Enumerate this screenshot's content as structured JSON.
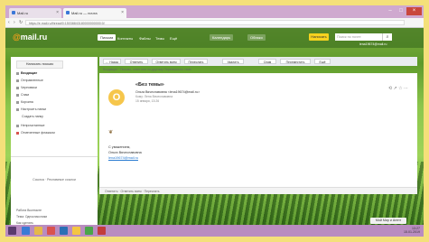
{
  "browser": {
    "tabs": [
      {
        "label": "Mail.ru",
        "active": false
      },
      {
        "label": "Mail.ru — почта",
        "active": true
      }
    ],
    "window_buttons": [
      "–",
      "□",
      "×"
    ],
    "url": "https://e.mail.ru/thread/0:15038843180000000000:0/",
    "nav": {
      "back": "‹",
      "forward": "›",
      "reload": "↻"
    }
  },
  "mailru": {
    "logo_prefix": "@",
    "logo_text": "mail",
    "logo_suffix": ".ru",
    "nav": [
      "Письма",
      "Контакты",
      "Файлы",
      "Темы",
      "Ещё"
    ],
    "calendar": "Календарь",
    "cloud": "Облако",
    "yellow_button": "Написать",
    "search_placeholder": "Поиск по почте",
    "search_icon": "⌕",
    "user_email": "lena19674@mail.ru"
  },
  "sidebar": {
    "compose": "Написать письмо",
    "folders": [
      {
        "label": "Входящие",
        "selected": true
      },
      {
        "label": "Отправленные",
        "selected": false
      },
      {
        "label": "Черновики",
        "selected": false
      },
      {
        "label": "Спам",
        "selected": false
      },
      {
        "label": "Корзина",
        "selected": false
      },
      {
        "label": "Настроить папки",
        "selected": false
      },
      {
        "label": "Создать папку",
        "selected": false
      },
      {
        "label": "Непрочитанные",
        "selected": false
      },
      {
        "label": "Отмеченные флажком",
        "selected": false
      }
    ],
    "ad_text": "Ссылка · Рекламные ссылки",
    "footer": [
      "Работа Вконтакте",
      "Тема: Одноклассники",
      "Как сделать"
    ]
  },
  "toolbar": {
    "buttons": [
      "← Назад",
      "Ответить",
      "Ответить всем",
      "Переслать",
      "Удалить",
      "Спам",
      "Переместить",
      "Ещё"
    ]
  },
  "breadcrumb": "Входящие · Письмо, ответ или по-другому Переписка по теме",
  "message": {
    "avatar_letter": "О",
    "subject": "«Без темы»",
    "sender": "Ольга Вячеславовна <lena19674@mail.ru>",
    "to": "Кому: Лена Вячеславовна",
    "date": "15 января, 13:26",
    "action_icons": "⟲ ↗ ☆ ⋯",
    "body_icon": "❦",
    "signature": [
      "С уважением,",
      "Ольга Вячеславовна"
    ],
    "signature_link": "lena19674@mail.ru"
  },
  "reply_bar": "Ответить  ·  Ответить всем  ·  Переслать",
  "chat_button": "Мой Мир и Агент",
  "taskbar": {
    "time": "13:27",
    "date": "15.01.2019"
  }
}
